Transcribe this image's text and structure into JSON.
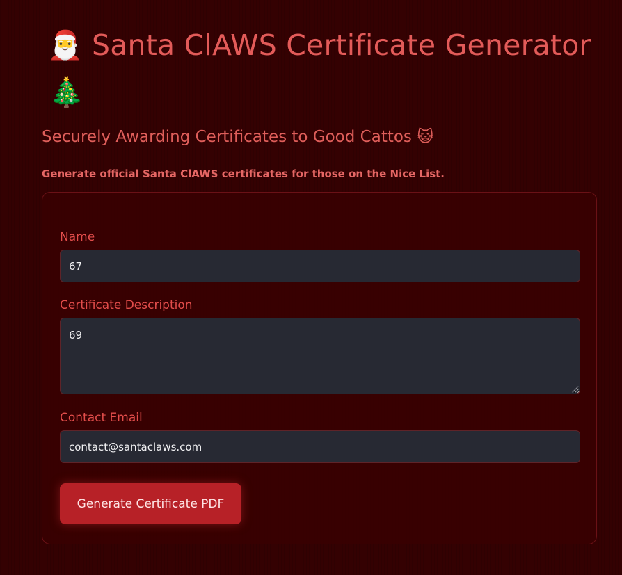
{
  "header": {
    "title_emoji": "🎅",
    "title_text": "Santa ClAWS Certificate Generator",
    "tree_emoji": "🎄",
    "subtitle": "Securely Awarding Certificates to Good Cattos 😺",
    "intro": "Generate official Santa ClAWS certificates for those on the Nice List."
  },
  "form": {
    "name_label": "Name",
    "name_value": "67",
    "description_label": "Certificate Description",
    "description_value": "69",
    "email_label": "Contact Email",
    "email_value": "contact@santaclaws.com",
    "submit_label": "Generate Certificate PDF"
  },
  "colors": {
    "background": "#340102",
    "accent": "#e35b59",
    "button": "#b72127",
    "input_background": "#272933"
  }
}
